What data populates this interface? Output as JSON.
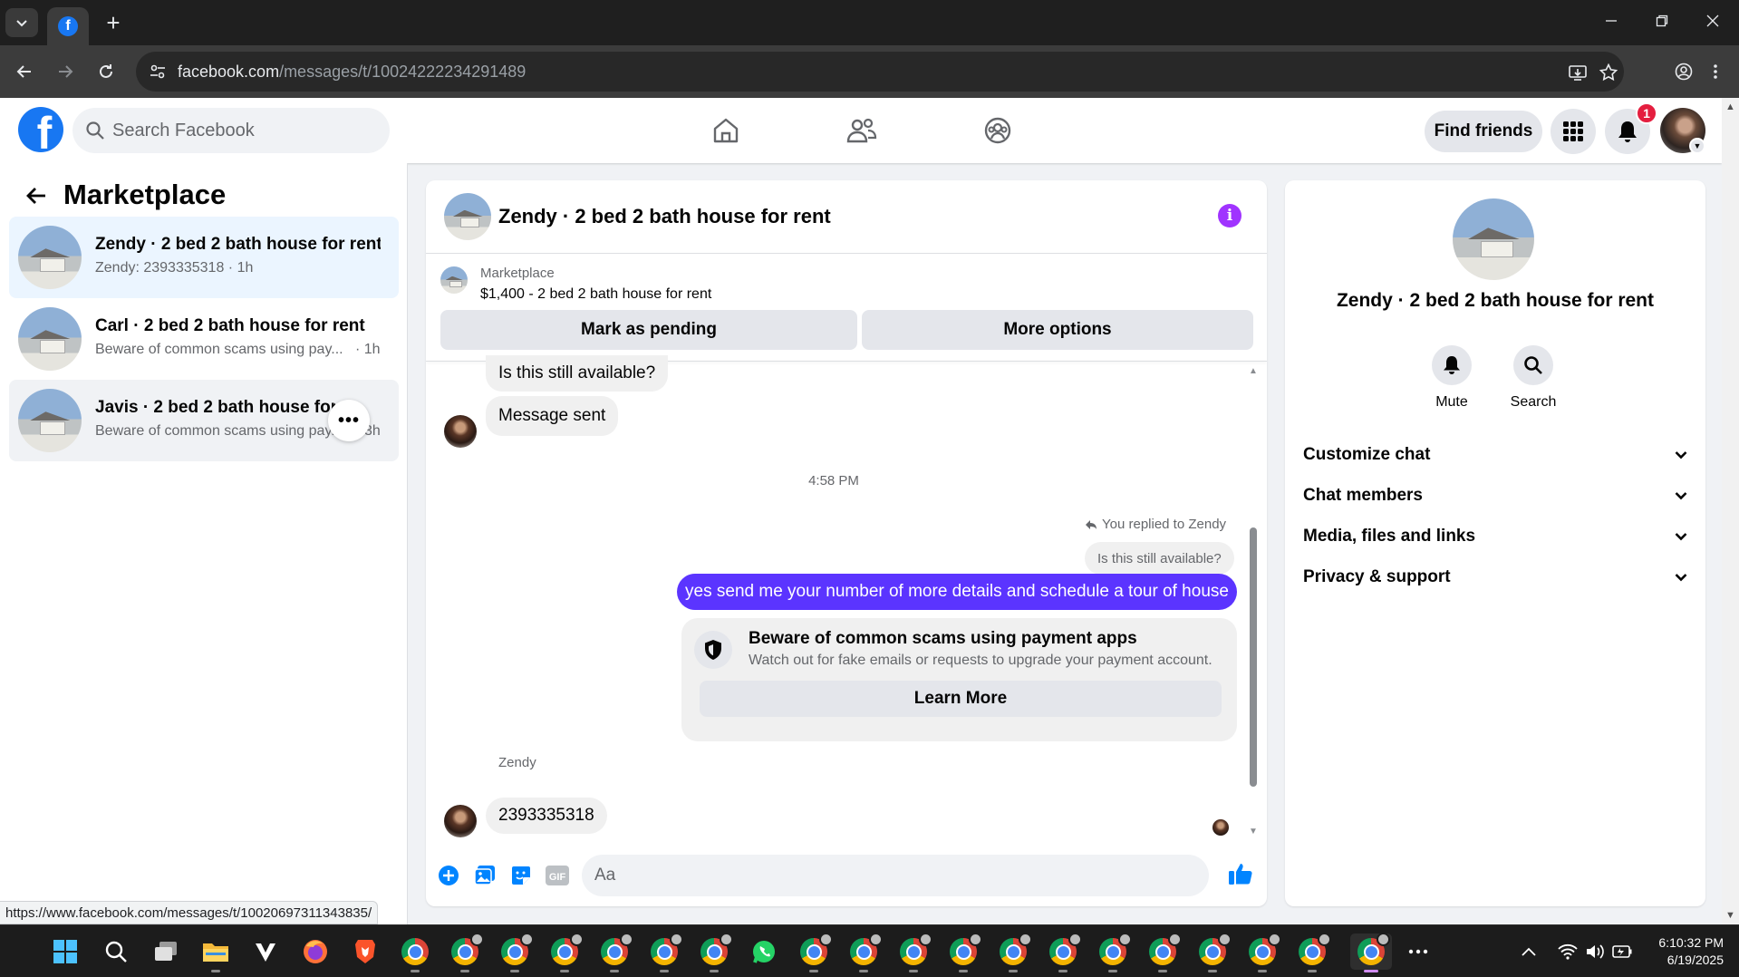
{
  "browser": {
    "url": "facebook.com/messages/t/10024222234291489",
    "url_host": "facebook.com",
    "url_path": "/messages/t/10024222234291489"
  },
  "header": {
    "search_placeholder": "Search Facebook",
    "find_friends": "Find friends",
    "notification_count": "1"
  },
  "left": {
    "title": "Marketplace",
    "conversations": [
      {
        "name": "Zendy · 2 bed 2 bath house for rent",
        "preview": "Zendy: 2393335318",
        "time": " · 1h"
      },
      {
        "name": "Carl · 2 bed 2 bath house for rent",
        "preview": "Beware of common scams using pay...",
        "time": "· 1h"
      },
      {
        "name": "Javis · 2 bed 2 bath house for rent",
        "preview": "Beware of common scams using pay...",
        "time": "3h"
      }
    ],
    "more_button": "•••"
  },
  "chat": {
    "title": "Zendy · 2 bed 2 bath house for rent",
    "marketplace_label": "Marketplace",
    "listing": "$1,400 - 2 bed 2 bath house for rent",
    "mark_pending": "Mark as pending",
    "more_options": "More options",
    "msg1": "Is this still available?",
    "msg2": "Message sent",
    "timestamp": "4:58 PM",
    "replied_to": "You replied to Zendy",
    "quoted": "Is this still available?",
    "sent": "yes send me your number of more details and schedule a tour of house",
    "scam_title": "Beware of common scams using payment apps",
    "scam_sub": "Watch out for fake emails or requests to upgrade your payment account.",
    "learn_more": "Learn More",
    "sender": "Zendy",
    "reply": "2393335318",
    "composer_placeholder": "Aa"
  },
  "right": {
    "title": "Zendy · 2 bed 2 bath house for rent",
    "mute": "Mute",
    "search": "Search",
    "rows": [
      "Customize chat",
      "Chat members",
      "Media, files and links",
      "Privacy & support"
    ]
  },
  "status_url": "https://www.facebook.com/messages/t/10020697311343835/",
  "taskbar": {
    "time": "6:10:32 PM",
    "date": "6/19/2025"
  },
  "colors": {
    "fb_blue": "#1877f2",
    "sent_bubble": "#5b34ff",
    "info_purple": "#a033ff",
    "badge_red": "#e41e3f"
  }
}
